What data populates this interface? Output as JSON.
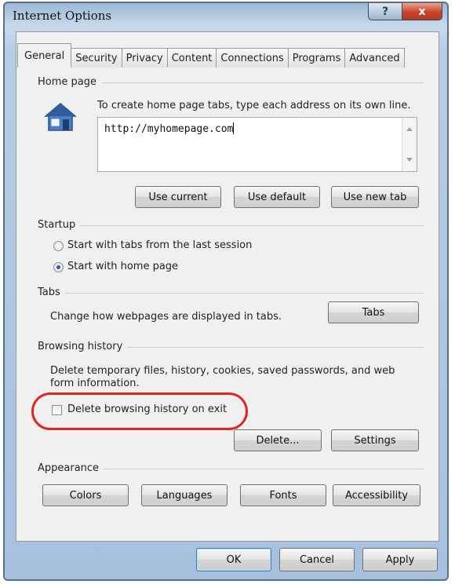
{
  "window": {
    "title": "Internet Options",
    "help_label": "?",
    "close_label": "x"
  },
  "tabs": [
    {
      "label": "General",
      "active": true
    },
    {
      "label": "Security",
      "active": false
    },
    {
      "label": "Privacy",
      "active": false
    },
    {
      "label": "Content",
      "active": false
    },
    {
      "label": "Connections",
      "active": false
    },
    {
      "label": "Programs",
      "active": false
    },
    {
      "label": "Advanced",
      "active": false
    }
  ],
  "home_page": {
    "heading": "Home page",
    "description": "To create home page tabs, type each address on its own line.",
    "url_value": "http://myhomepage.com",
    "use_current": "Use current",
    "use_default": "Use default",
    "use_new_tab": "Use new tab",
    "icon": "house-icon"
  },
  "startup": {
    "heading": "Startup",
    "option_last_session": "Start with tabs from the last session",
    "option_home_page": "Start with home page",
    "selected": "option_home_page"
  },
  "tabs_section": {
    "heading": "Tabs",
    "description": "Change how webpages are displayed in tabs.",
    "button": "Tabs"
  },
  "browsing_history": {
    "heading": "Browsing history",
    "description_line1": "Delete temporary files, history, cookies, saved passwords, and web",
    "description_line2": "form information.",
    "delete_on_exit_label": "Delete browsing history on exit",
    "delete_on_exit_checked": false,
    "delete_button": "Delete...",
    "settings_button": "Settings"
  },
  "appearance": {
    "heading": "Appearance",
    "colors": "Colors",
    "languages": "Languages",
    "fonts": "Fonts",
    "accessibility": "Accessibility"
  },
  "footer": {
    "ok": "OK",
    "cancel": "Cancel",
    "apply": "Apply"
  },
  "colors": {
    "highlight_ring": "#e0261f",
    "title_gradient": "#9cb7d6",
    "close_button": "#c8432a"
  }
}
